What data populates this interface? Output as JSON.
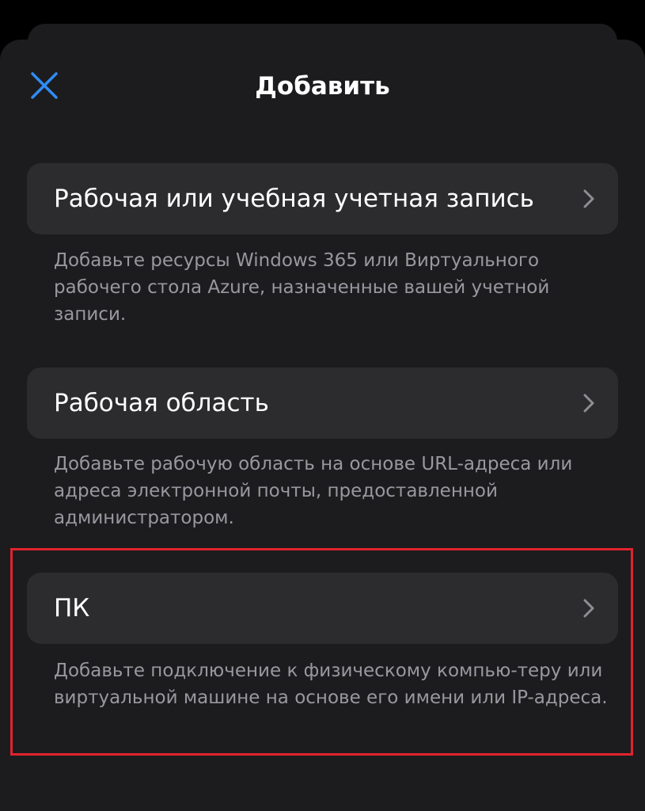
{
  "header": {
    "title": "Добавить",
    "close_icon": "close-icon",
    "accent_color": "#2f8cf5"
  },
  "options": [
    {
      "label": "Рабочая или учебная учетная запись",
      "description": "Добавьте ресурсы Windows 365 или Виртуального рабочего стола Azure, назначенные вашей учетной записи.",
      "icon": "chevron-right-icon"
    },
    {
      "label": "Рабочая область",
      "description": "Добавьте рабочую область на основе URL-адреса или адреса электронной почты, предоставленной администратором.",
      "icon": "chevron-right-icon"
    },
    {
      "label": "ПК",
      "description": "Добавьте подключение к физическому компью-теру или виртуальной машине на основе его имени или IP-адреса.",
      "icon": "chevron-right-icon"
    }
  ],
  "colors": {
    "background": "#000000",
    "sheet": "#1c1c1e",
    "row": "#2c2c2e",
    "description_text": "#98989f",
    "highlight": "#e0232e"
  }
}
